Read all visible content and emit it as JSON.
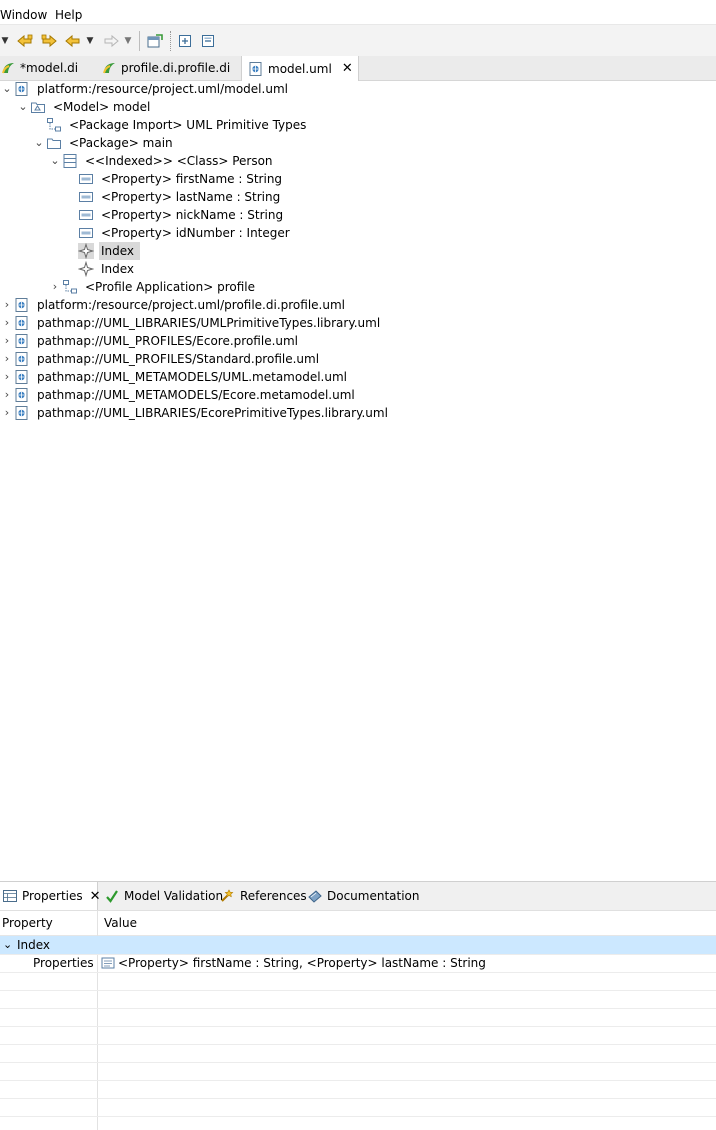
{
  "menu": {
    "window": "Window",
    "help": "Help"
  },
  "tabs": [
    {
      "label": "*model.di",
      "icon": "papyrus-di-icon"
    },
    {
      "label": "profile.di.profile.di",
      "icon": "papyrus-di-icon"
    },
    {
      "label": "model.uml",
      "icon": "uml-model-icon",
      "active": true
    }
  ],
  "tree": {
    "root": "platform:/resource/project.uml/model.uml",
    "model": "<Model> model",
    "package_import": "<Package Import> UML Primitive Types",
    "package": "<Package> main",
    "class": "<<Indexed>> <Class> Person",
    "properties": [
      "<Property> firstName : String",
      "<Property> lastName : String",
      "<Property> nickName : String",
      "<Property> idNumber : Integer"
    ],
    "index_selected": "Index",
    "index_second": "Index",
    "profile_application": "<Profile Application> profile",
    "resources": [
      "platform:/resource/project.uml/profile.di.profile.uml",
      "pathmap://UML_LIBRARIES/UMLPrimitiveTypes.library.uml",
      "pathmap://UML_PROFILES/Ecore.profile.uml",
      "pathmap://UML_PROFILES/Standard.profile.uml",
      "pathmap://UML_METAMODELS/UML.metamodel.uml",
      "pathmap://UML_METAMODELS/Ecore.metamodel.uml",
      "pathmap://UML_LIBRARIES/EcorePrimitiveTypes.library.uml"
    ]
  },
  "bottom": {
    "tabs": {
      "properties": "Properties",
      "model_validation": "Model Validation",
      "references": "References",
      "documentation": "Documentation"
    },
    "columns": {
      "property": "Property",
      "value": "Value"
    },
    "category": "Index",
    "row": {
      "name": "Properties",
      "value": "<Property> firstName : String, <Property> lastName : String"
    }
  },
  "colors": {
    "selection": "#cce8ff",
    "tree_selection": "#d9d9d9",
    "accent_green": "#3a9b3a",
    "arrow_yellow": "#e0a800"
  }
}
